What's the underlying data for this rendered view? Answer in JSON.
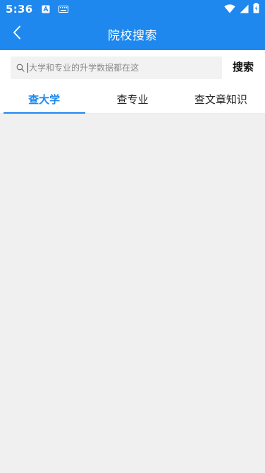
{
  "status_bar": {
    "time": "5:36",
    "icons": [
      "notification-a-icon",
      "keyboard-icon",
      "wifi-icon",
      "signal-icon",
      "battery-icon"
    ]
  },
  "app_bar": {
    "title": "院校搜索",
    "back_icon": "chevron-left-icon",
    "background": "#1e88ee"
  },
  "search": {
    "placeholder": "大学和专业的升学数据都在这",
    "value": "",
    "button_label": "搜索"
  },
  "tabs": [
    {
      "label": "查大学",
      "active": true
    },
    {
      "label": "查专业",
      "active": false
    },
    {
      "label": "查文章知识",
      "active": false
    }
  ],
  "colors": {
    "accent": "#1e88ee",
    "page_background": "#f0f0f0"
  }
}
